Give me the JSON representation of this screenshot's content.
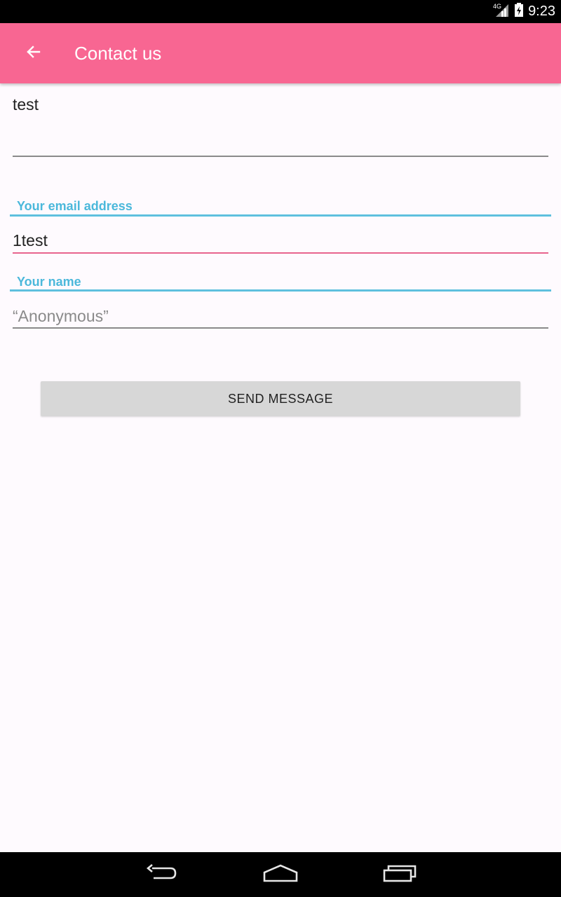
{
  "status_bar": {
    "network": "4G",
    "time": "9:23"
  },
  "app_bar": {
    "title": "Contact us",
    "back_icon": "arrow-back-icon",
    "color": "#f86692"
  },
  "form": {
    "message": {
      "value": "test"
    },
    "email": {
      "label": "Your email address",
      "value": "1test"
    },
    "name": {
      "label": "Your name",
      "placeholder": "“Anonymous”"
    },
    "send_label": "SEND MESSAGE"
  },
  "colors": {
    "accent": "#f86692",
    "label": "#4bb8db",
    "error_underline": "#e8648e"
  },
  "nav_bar": {
    "back_icon": "nav-back-icon",
    "home_icon": "nav-home-icon",
    "recents_icon": "nav-recents-icon"
  }
}
